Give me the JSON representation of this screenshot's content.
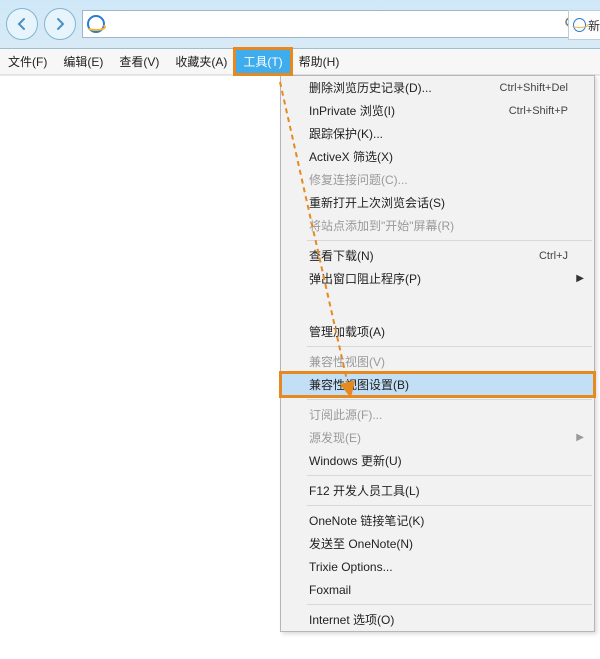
{
  "tab": {
    "label": "新"
  },
  "menubar": {
    "file": "文件(F)",
    "edit": "编辑(E)",
    "view": "查看(V)",
    "favorites": "收藏夹(A)",
    "tools": "工具(T)",
    "help": "帮助(H)"
  },
  "menu": {
    "delete_history": {
      "label": "删除浏览历史记录(D)...",
      "shortcut": "Ctrl+Shift+Del"
    },
    "inprivate": {
      "label": "InPrivate 浏览(I)",
      "shortcut": "Ctrl+Shift+P"
    },
    "tracking": {
      "label": "跟踪保护(K)..."
    },
    "activex": {
      "label": "ActiveX 筛选(X)"
    },
    "fix_conn": {
      "label": "修复连接问题(C)..."
    },
    "reopen": {
      "label": "重新打开上次浏览会话(S)"
    },
    "add_start": {
      "label": "将站点添加到\"开始\"屏幕(R)"
    },
    "downloads": {
      "label": "查看下载(N)",
      "shortcut": "Ctrl+J"
    },
    "popup": {
      "label": "弹出窗口阻止程序(P)"
    },
    "garbled": {
      "label": "管理加载项(A)"
    },
    "compat_view": {
      "label": "兼容性视图(V)"
    },
    "compat_settings": {
      "label": "兼容性视图设置(B)"
    },
    "subscribe": {
      "label": "订阅此源(F)..."
    },
    "feed_discover": {
      "label": "源发现(E)"
    },
    "win_update": {
      "label": "Windows 更新(U)"
    },
    "f12": {
      "label": "F12 开发人员工具(L)"
    },
    "onenote_link": {
      "label": "OneNote 链接笔记(K)"
    },
    "onenote_send": {
      "label": "发送至 OneNote(N)"
    },
    "trixie": {
      "label": "Trixie Options..."
    },
    "foxmail": {
      "label": "Foxmail"
    },
    "options": {
      "label": "Internet 选项(O)"
    }
  }
}
